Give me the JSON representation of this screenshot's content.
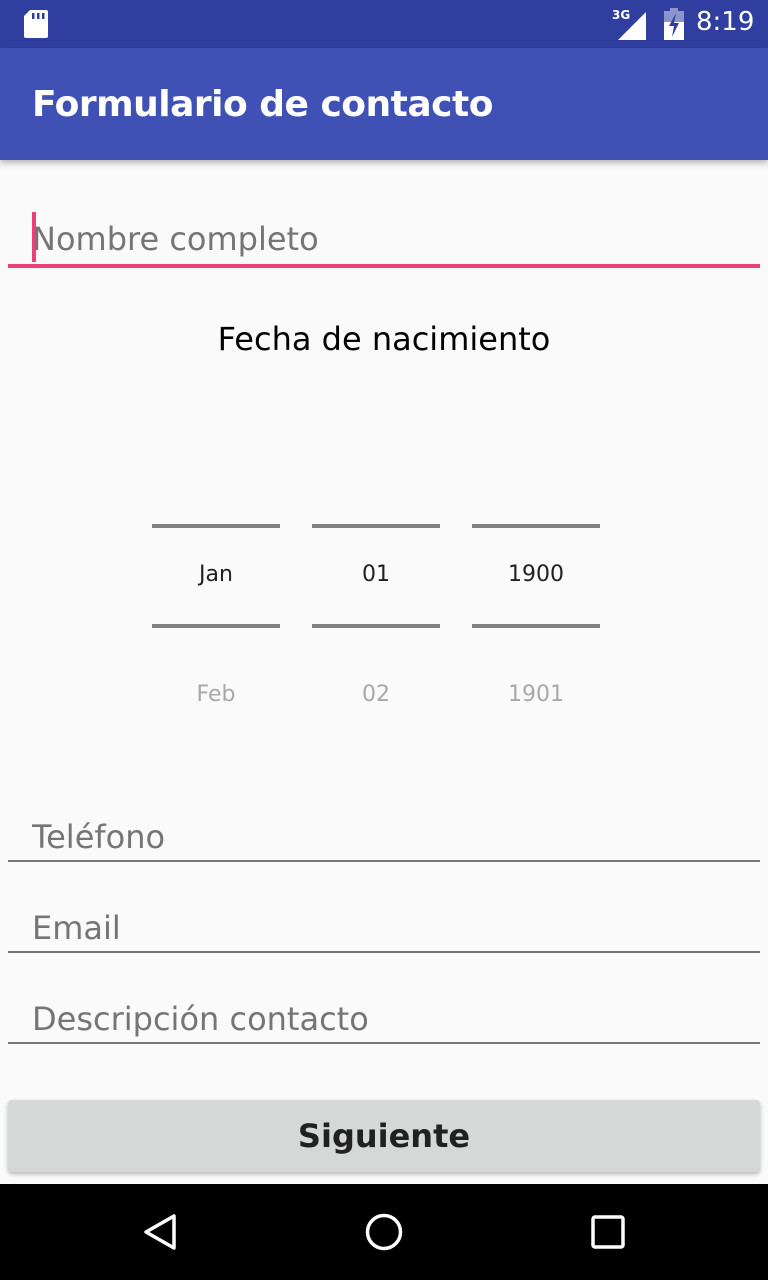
{
  "status_bar": {
    "time": "8:19",
    "network": "3G",
    "icons": [
      "sd-card-icon",
      "signal-icon",
      "battery-icon"
    ]
  },
  "app_bar": {
    "title": "Formulario de contacto",
    "color": "#3f51b5"
  },
  "form": {
    "name_placeholder": "Nombre completo",
    "dob_label": "Fecha de nacimiento",
    "date_picker": {
      "month": {
        "selected": "Jan",
        "next": "Feb"
      },
      "day": {
        "selected": "01",
        "next": "02"
      },
      "year": {
        "selected": "1900",
        "next": "1901"
      }
    },
    "phone_placeholder": "Teléfono",
    "email_placeholder": "Email",
    "description_placeholder": "Descripción contacto",
    "next_button": "Siguiente"
  },
  "nav_bar": {
    "icons": [
      "back-icon",
      "home-icon",
      "recent-apps-icon"
    ]
  },
  "colors": {
    "status_bar": "#303f9f",
    "accent": "#ec407a",
    "button": "#d6d7d7"
  }
}
